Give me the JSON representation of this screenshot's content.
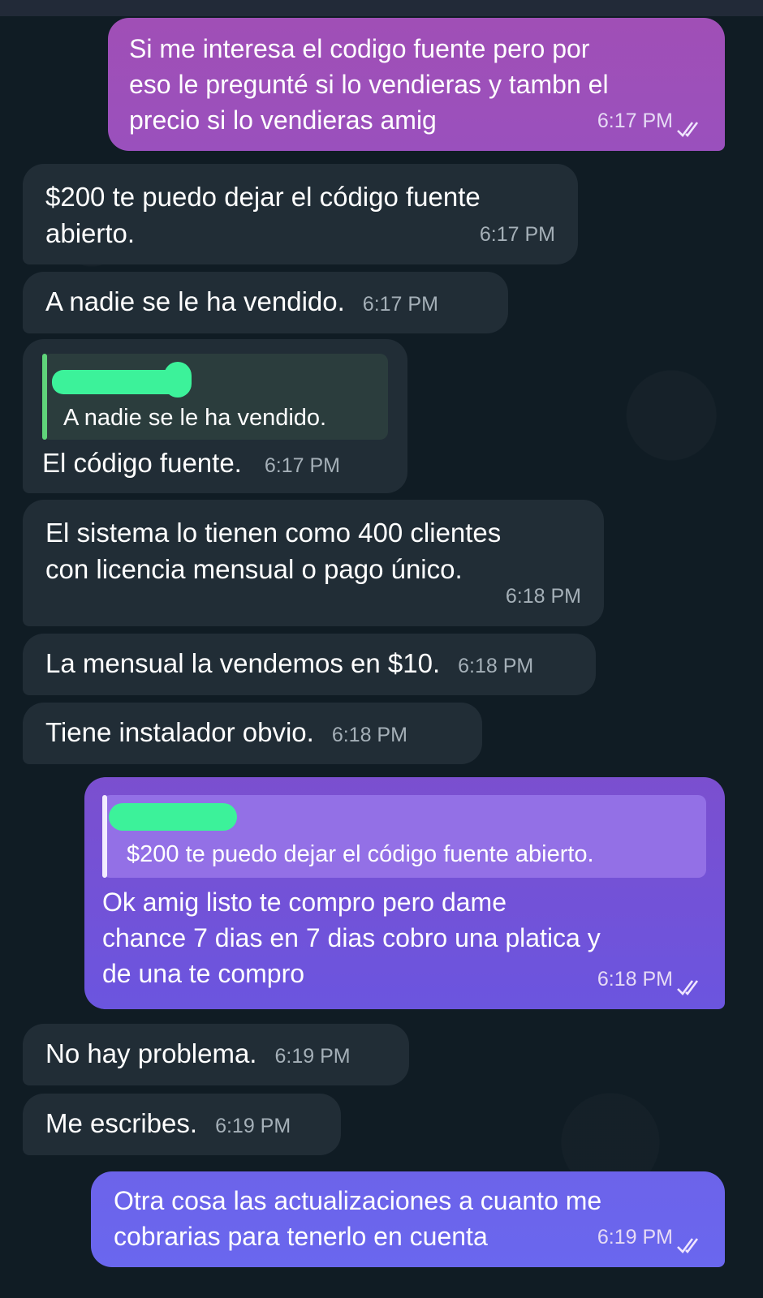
{
  "messages": [
    {
      "direction": "outgoing",
      "text": "Si me interesa el codigo fuente pero por\neso le pregunté si lo vendieras y tambn el\nprecio si lo vendieras amig",
      "time": "6:17 PM",
      "status_icon": "double-check-icon"
    },
    {
      "direction": "incoming",
      "text": "$200 te puedo dejar el código fuente\nabierto.",
      "time": "6:17 PM"
    },
    {
      "direction": "incoming",
      "text": "A nadie se le ha vendido.",
      "time": "6:17 PM"
    },
    {
      "direction": "incoming",
      "reply_quote": "A nadie se le ha vendido.",
      "text": "El código fuente.",
      "time": "6:17 PM"
    },
    {
      "direction": "incoming",
      "text": "El sistema lo tienen como 400 clientes\ncon licencia mensual o pago único.",
      "time": "6:18 PM"
    },
    {
      "direction": "incoming",
      "text": "La mensual la vendemos en $10.",
      "time": "6:18 PM"
    },
    {
      "direction": "incoming",
      "text": "Tiene instalador obvio.",
      "time": "6:18 PM"
    },
    {
      "direction": "outgoing",
      "reply_quote": "$200 te puedo dejar el código fuente abierto.",
      "text": "Ok amig listo te compro pero dame\nchance 7 dias en 7 dias cobro una platica y\nde una te compro",
      "time": "6:18 PM",
      "status_icon": "double-check-icon"
    },
    {
      "direction": "incoming",
      "text": "No hay problema.",
      "time": "6:19 PM"
    },
    {
      "direction": "incoming",
      "text": "Me escribes.",
      "time": "6:19 PM"
    },
    {
      "direction": "outgoing",
      "text": "Otra cosa las actualizaciones a cuanto me\ncobrarias para tenerlo en cuenta",
      "time": "6:19 PM",
      "status_icon": "double-check-icon"
    }
  ],
  "colors": {
    "background": "#101c24",
    "incoming_bubble": "#212d36",
    "outgoing_gradient_top": "#9a4fb8",
    "outgoing_gradient_bottom": "#6a5cf0",
    "quote_bar_incoming": "#5fd47a",
    "redaction": "#3cf29a"
  }
}
